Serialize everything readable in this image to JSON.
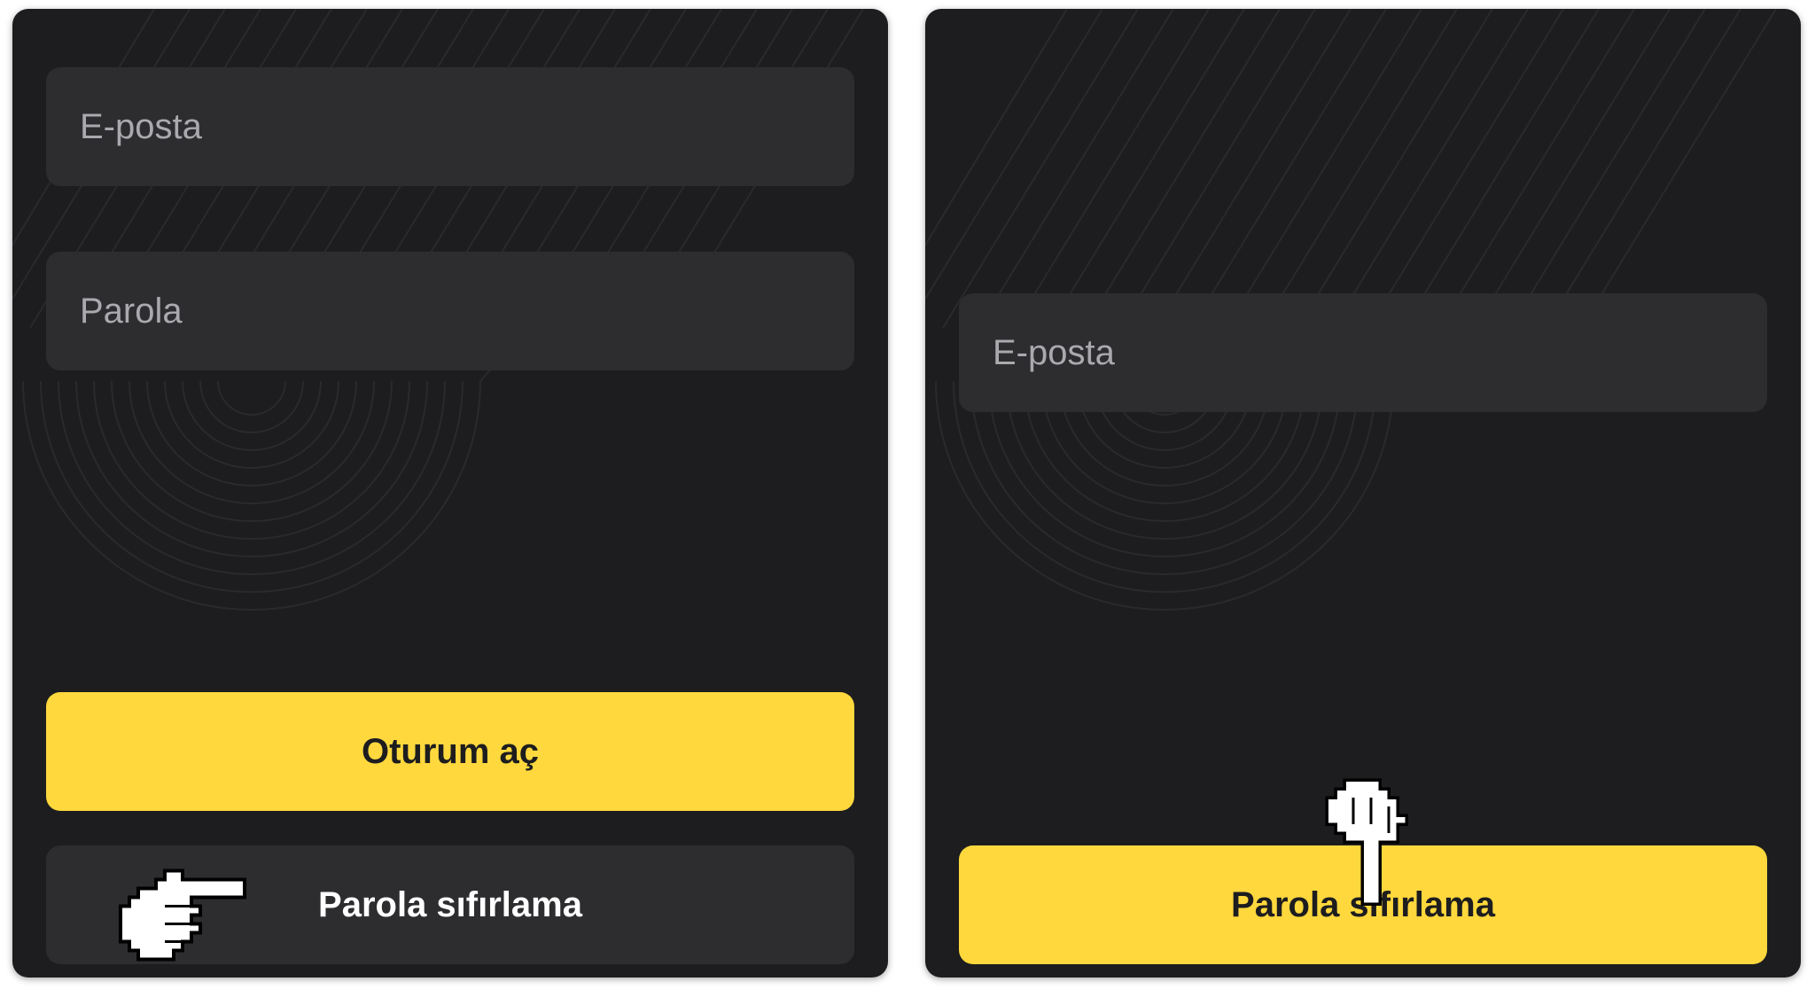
{
  "login_screen": {
    "email_placeholder": "E-posta",
    "password_placeholder": "Parola",
    "login_button_label": "Oturum aç",
    "reset_button_label": "Parola sıfırlama"
  },
  "reset_screen": {
    "email_placeholder": "E-posta",
    "reset_button_label": "Parola sıfırlama"
  },
  "colors": {
    "panel_background": "#1d1d1f",
    "field_background": "#2d2d30",
    "accent_yellow": "#ffd83d",
    "placeholder_text": "#a9a9ae"
  },
  "icons": [
    "pointing-hand-cursor-icon",
    "hand-pointer-cursor-icon"
  ]
}
